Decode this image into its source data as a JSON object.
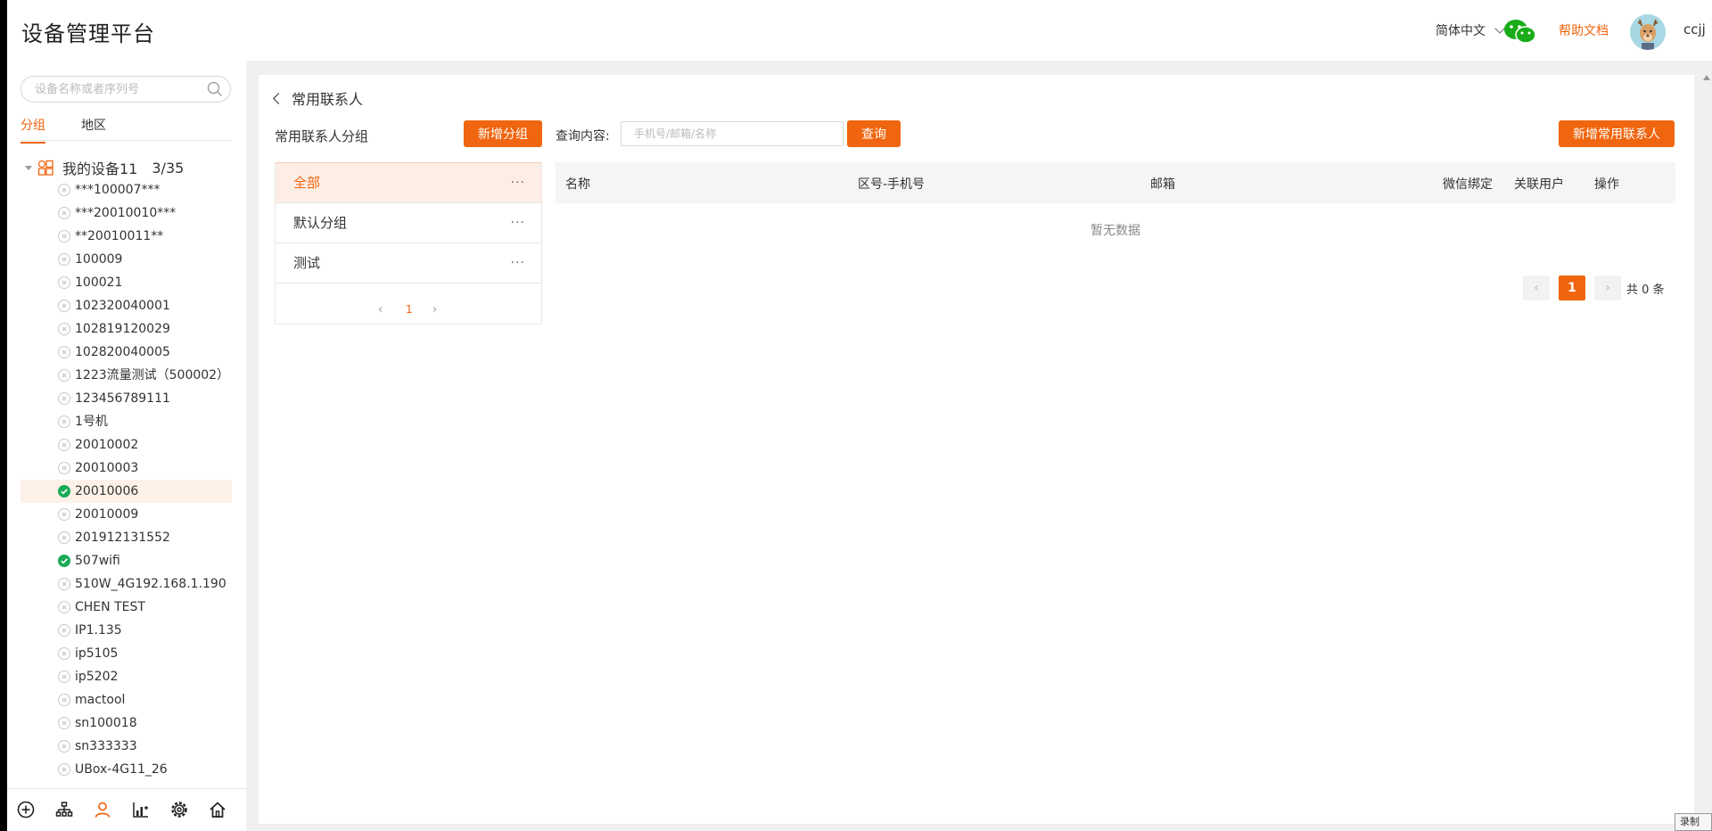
{
  "header": {
    "app_title": "设备管理平台",
    "language": "简体中文",
    "help_label": "帮助文档",
    "username": "ccjj"
  },
  "sidebar": {
    "search_placeholder": "设备名称或者序列号",
    "tabs": [
      "分组",
      "地区"
    ],
    "active_tab": "分组",
    "root": {
      "label": "我的设备11",
      "count": "3/35"
    },
    "devices": [
      {
        "label": "***100007***",
        "online": false
      },
      {
        "label": "***20010010***",
        "online": false
      },
      {
        "label": "**20010011**",
        "online": false
      },
      {
        "label": "100009",
        "online": false
      },
      {
        "label": "100021",
        "online": false
      },
      {
        "label": "102320040001",
        "online": false
      },
      {
        "label": "102819120029",
        "online": false
      },
      {
        "label": "102820040005",
        "online": false
      },
      {
        "label": "1223流量测试（500002）",
        "online": false
      },
      {
        "label": "123456789111",
        "online": false
      },
      {
        "label": "1号机",
        "online": false
      },
      {
        "label": "20010002",
        "online": false
      },
      {
        "label": "20010003",
        "online": false
      },
      {
        "label": "20010006",
        "online": true,
        "selected": true
      },
      {
        "label": "20010009",
        "online": false
      },
      {
        "label": "201912131552",
        "online": false
      },
      {
        "label": "507wifi",
        "online": true
      },
      {
        "label": "510W_4G192.168.1.190",
        "online": false
      },
      {
        "label": "CHEN TEST",
        "online": false
      },
      {
        "label": "IP1.135",
        "online": false
      },
      {
        "label": "ip5105",
        "online": false
      },
      {
        "label": "ip5202",
        "online": false
      },
      {
        "label": "mactool",
        "online": false
      },
      {
        "label": "sn100018",
        "online": false
      },
      {
        "label": "sn333333",
        "online": false
      },
      {
        "label": "UBox-4G11_26",
        "online": false
      }
    ],
    "bottom_icons": [
      "add-circle-icon",
      "org-tree-icon",
      "user-icon",
      "chart-icon",
      "settings-gear-icon",
      "home-icon"
    ]
  },
  "main": {
    "breadcrumb": "常用联系人",
    "group_panel_title": "常用联系人分组",
    "add_group_button": "新增分组",
    "query_label": "查询内容:",
    "query_placeholder": "手机号/邮箱/名称",
    "query_button": "查询",
    "add_contact_button": "新增常用联系人",
    "groups": [
      {
        "label": "全部",
        "active": true
      },
      {
        "label": "默认分组",
        "active": false
      },
      {
        "label": "测试",
        "active": false
      }
    ],
    "more_label": "···",
    "group_pager": {
      "current": "1"
    },
    "table": {
      "columns": [
        "名称",
        "区号-手机号",
        "邮箱",
        "微信绑定",
        "关联用户",
        "操作"
      ],
      "rows": [],
      "empty_text": "暂无数据"
    },
    "pager": {
      "current": "1",
      "total_text": "共 0 条"
    }
  },
  "overlay": {
    "record_label": "录制"
  },
  "colors": {
    "accent": "#f0650f",
    "online": "#1aaa55",
    "offline": "#c8c8c8",
    "selected_bg": "#fef1e8"
  }
}
